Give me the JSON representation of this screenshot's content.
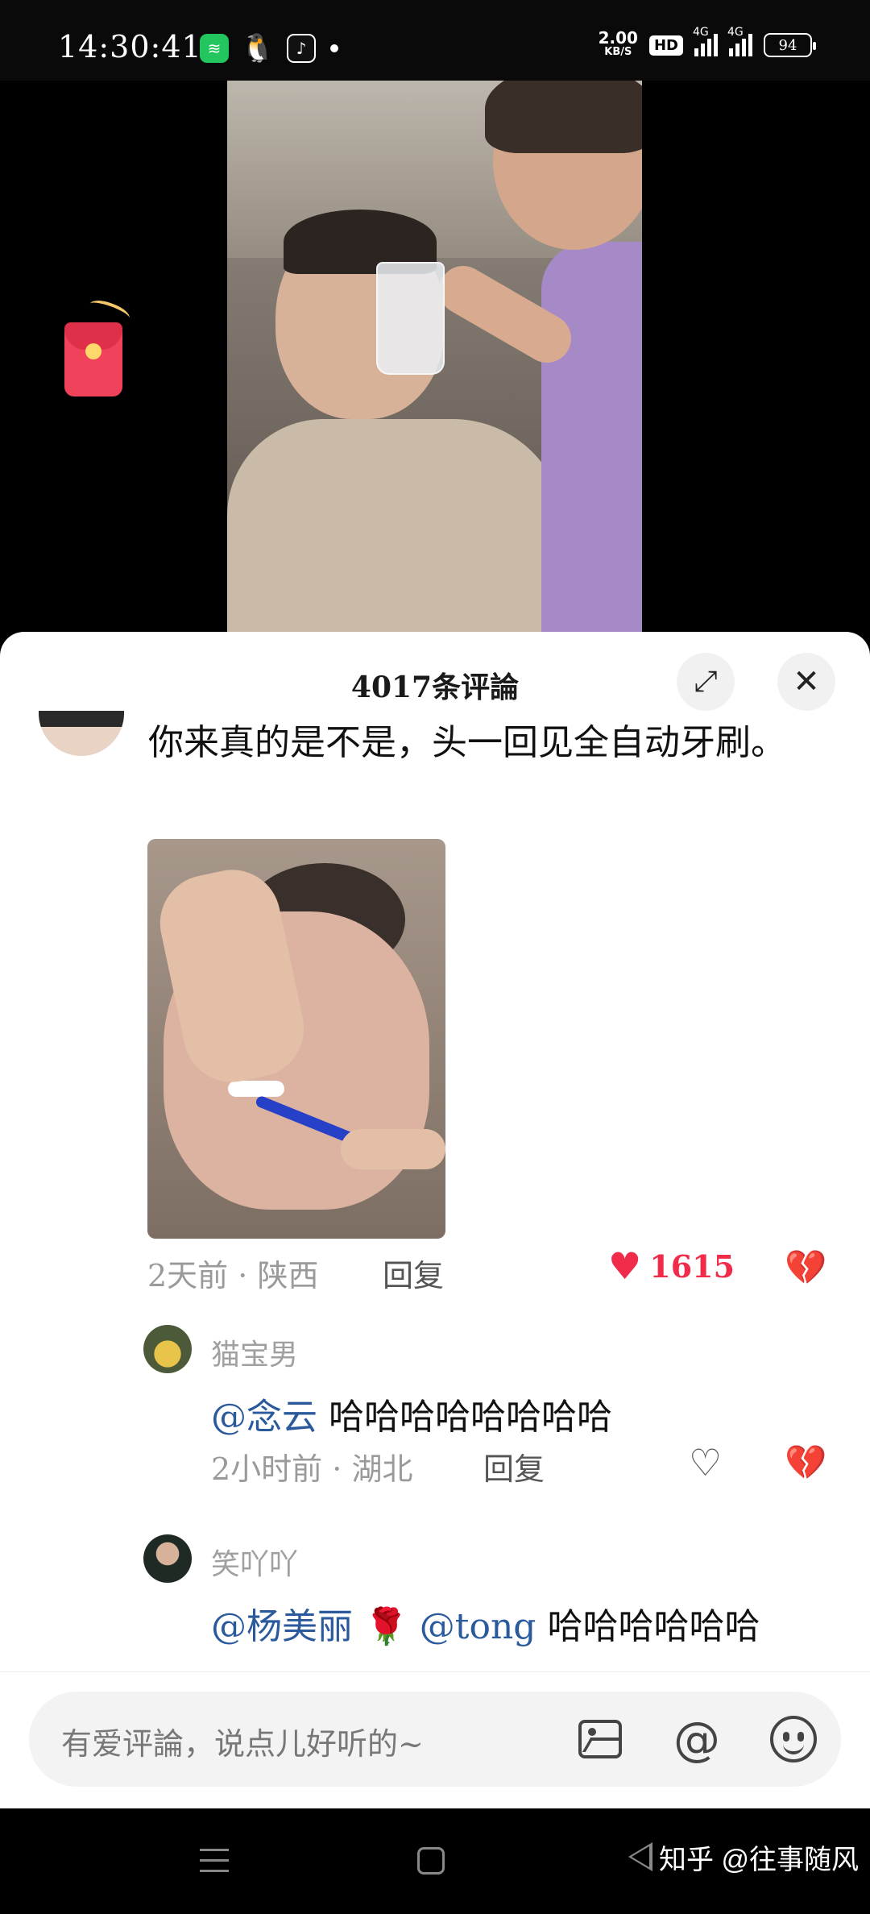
{
  "status_bar": {
    "time": "14:30:41",
    "net_speed_value": "2.00",
    "net_speed_unit": "KB/S",
    "hd_badge": "HD",
    "sig1_label": "4G",
    "sig2_label": "4G",
    "battery": "94"
  },
  "comments_sheet": {
    "title": "4017条评論",
    "main_comment": {
      "text": "你来真的是不是，头一回见全自动牙刷。",
      "time": "2天前",
      "location": "陕西",
      "reply_label": "回复",
      "like_count": "1615"
    },
    "replies": [
      {
        "username": "猫宝男",
        "mention": "@念云",
        "text": "哈哈哈哈哈哈哈哈",
        "time": "2小时前",
        "location": "湖北",
        "reply_label": "回复"
      },
      {
        "username": "笑吖吖",
        "mention1": "@杨美丽",
        "rose": "🌹",
        "mention2": "@tong",
        "text": "哈哈哈哈哈哈"
      }
    ]
  },
  "input_bar": {
    "placeholder": "有爱评論，说点儿好听的~",
    "at_symbol": "@"
  },
  "watermark": "知乎 @往事随风",
  "icons": [
    "red-packet-icon",
    "expand-icon",
    "close-icon",
    "heart-icon",
    "broken-heart-icon",
    "image-icon",
    "at-icon",
    "emoji-icon",
    "menu-icon",
    "home-icon",
    "back-icon"
  ],
  "colors": {
    "like_red": "#f02c4a",
    "mention_blue": "#2b5a9c"
  }
}
